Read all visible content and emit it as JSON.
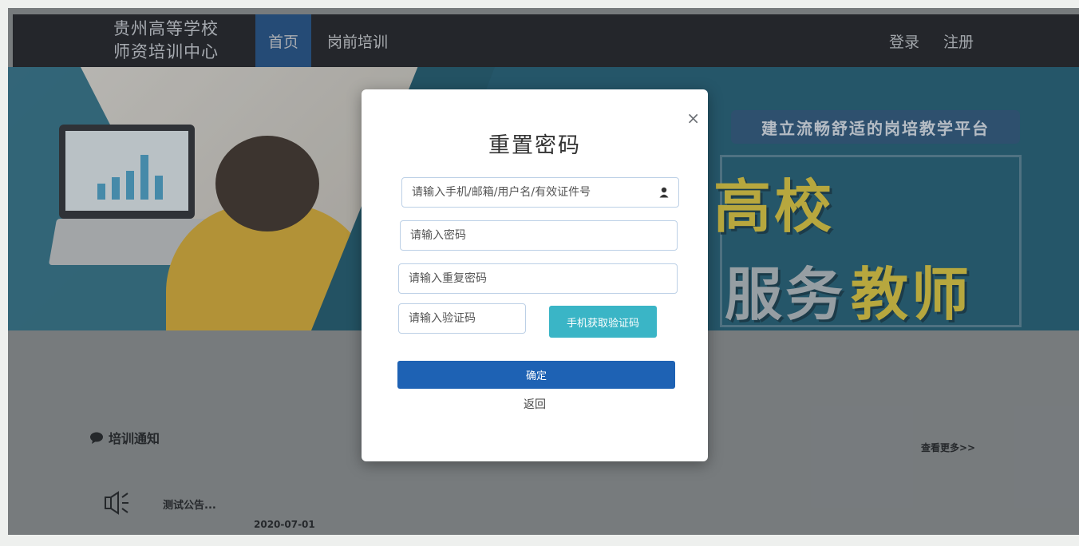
{
  "nav": {
    "logo_line1": "贵州高等学校",
    "logo_line2": "师资培训中心",
    "home": "首页",
    "pre_service": "岗前培训",
    "login": "登录",
    "register": "注册"
  },
  "banner": {
    "slogan": "建立流畅舒适的岗培教学平台",
    "big_text_1": "高校",
    "big_text_2": "服务",
    "big_text_3": "教师"
  },
  "notices": {
    "header": "培训通知",
    "view_more": "查看更多>>",
    "items": [
      {
        "title": "测试公告...",
        "date": "2020-07-01"
      }
    ]
  },
  "modal": {
    "title": "重置密码",
    "close_symbol": "×",
    "account_placeholder": "请输入手机/邮箱/用户名/有效证件号",
    "password_placeholder": "请输入密码",
    "repeat_password_placeholder": "请输入重复密码",
    "code_placeholder": "请输入验证码",
    "sms_button": "手机获取验证码",
    "confirm_button": "确定",
    "back_link": "返回"
  },
  "colors": {
    "nav_bg": "#1b1d22",
    "nav_active": "#1c4f8a",
    "sms_button": "#3ab5c6",
    "confirm_button": "#1e62b4",
    "banner_bg": "#1d5f78",
    "slogan_yellow": "#e6cf3c"
  }
}
